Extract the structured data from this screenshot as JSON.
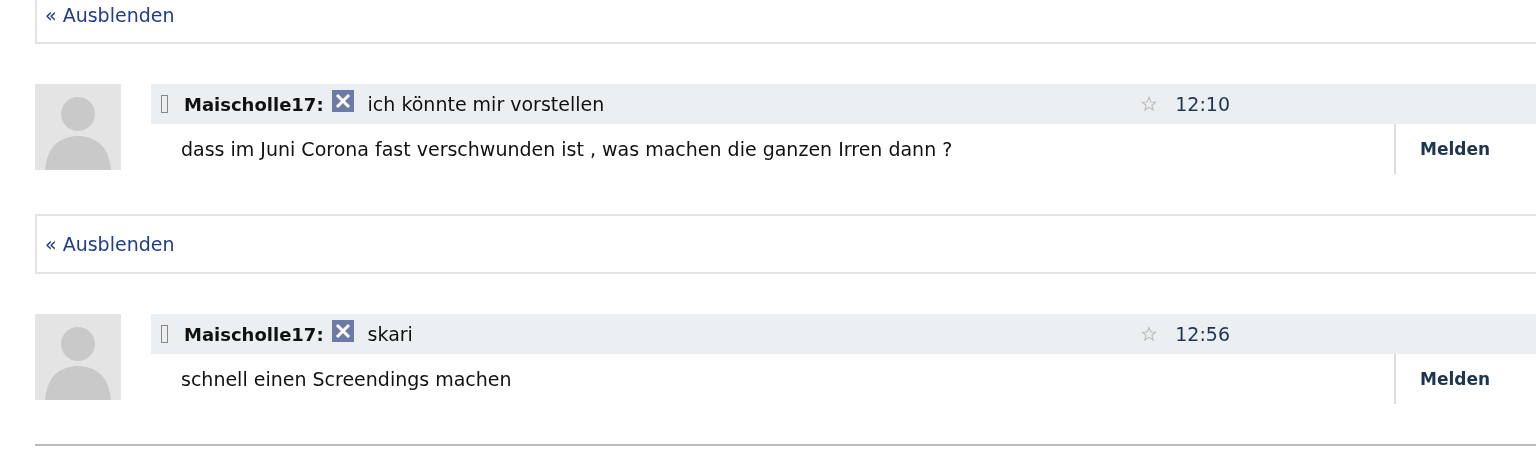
{
  "sections": [
    {
      "kind": "hide",
      "link": "« Ausblenden"
    },
    {
      "kind": "comment",
      "author": "Maischolle17:",
      "title": "ich könnte mir vorstellen",
      "time": "12:10",
      "body": "dass im Juni Corona fast verschwunden ist , was machen die ganzen Irren dann ?",
      "report": "Melden"
    },
    {
      "kind": "hide",
      "link": "« Ausblenden"
    },
    {
      "kind": "comment",
      "author": "Maischolle17:",
      "title": "skari",
      "time": "12:56",
      "body": "schnell einen Screendings machen",
      "report": "Melden"
    }
  ]
}
